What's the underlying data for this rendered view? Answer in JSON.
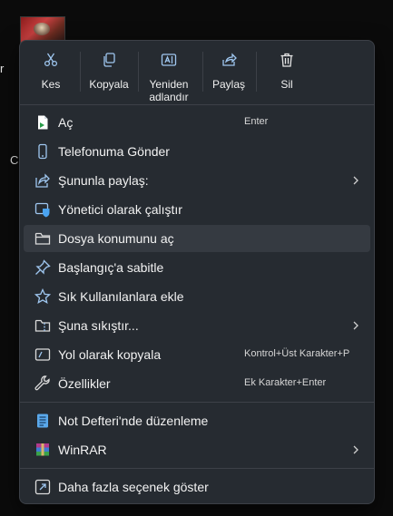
{
  "desktop": {
    "fragments": [
      "r",
      "Cl"
    ]
  },
  "toolbar": {
    "buttons": [
      {
        "label": "Kes",
        "icon": "scissors-icon"
      },
      {
        "label": "Kopyala",
        "icon": "copy-icon"
      },
      {
        "label": "Yeniden adlandır",
        "icon": "rename-icon"
      },
      {
        "label": "Paylaş",
        "icon": "share-icon"
      },
      {
        "label": "Sil",
        "icon": "trash-icon"
      }
    ]
  },
  "menu": {
    "items": [
      {
        "label": "Aç",
        "shortcut": "Enter",
        "icon": "open-file-icon"
      },
      {
        "label": "Telefonuma Gönder",
        "icon": "phone-icon"
      },
      {
        "label": "Şununla paylaş:",
        "icon": "share-with-icon",
        "submenu": true
      },
      {
        "label": "Yönetici olarak çalıştır",
        "icon": "admin-shield-icon"
      },
      {
        "label": "Dosya konumunu aç",
        "icon": "folder-icon"
      },
      {
        "label": "Başlangıç'a sabitle",
        "icon": "pin-icon"
      },
      {
        "label": "Sık Kullanılanlara ekle",
        "icon": "star-icon"
      },
      {
        "label": "Şuna sıkıştır...",
        "icon": "compress-folder-icon",
        "submenu": true
      },
      {
        "label": "Yol olarak kopyala",
        "shortcut": "Kontrol+Üst Karakter+P",
        "icon": "copy-path-icon"
      },
      {
        "label": "Özellikler",
        "shortcut": "Ek Karakter+Enter",
        "icon": "wrench-icon"
      },
      {
        "label": "Not Defteri'nde düzenleme",
        "icon": "notepad-icon"
      },
      {
        "label": "WinRAR",
        "icon": "winrar-icon",
        "submenu": true
      },
      {
        "label": "Daha fazla seçenek göster",
        "icon": "more-options-icon"
      }
    ]
  },
  "colors": {
    "menu_bg": "#262b31",
    "hover_bg": "#353a41",
    "accent": "#60b0f4",
    "text": "#f2f2f2"
  }
}
